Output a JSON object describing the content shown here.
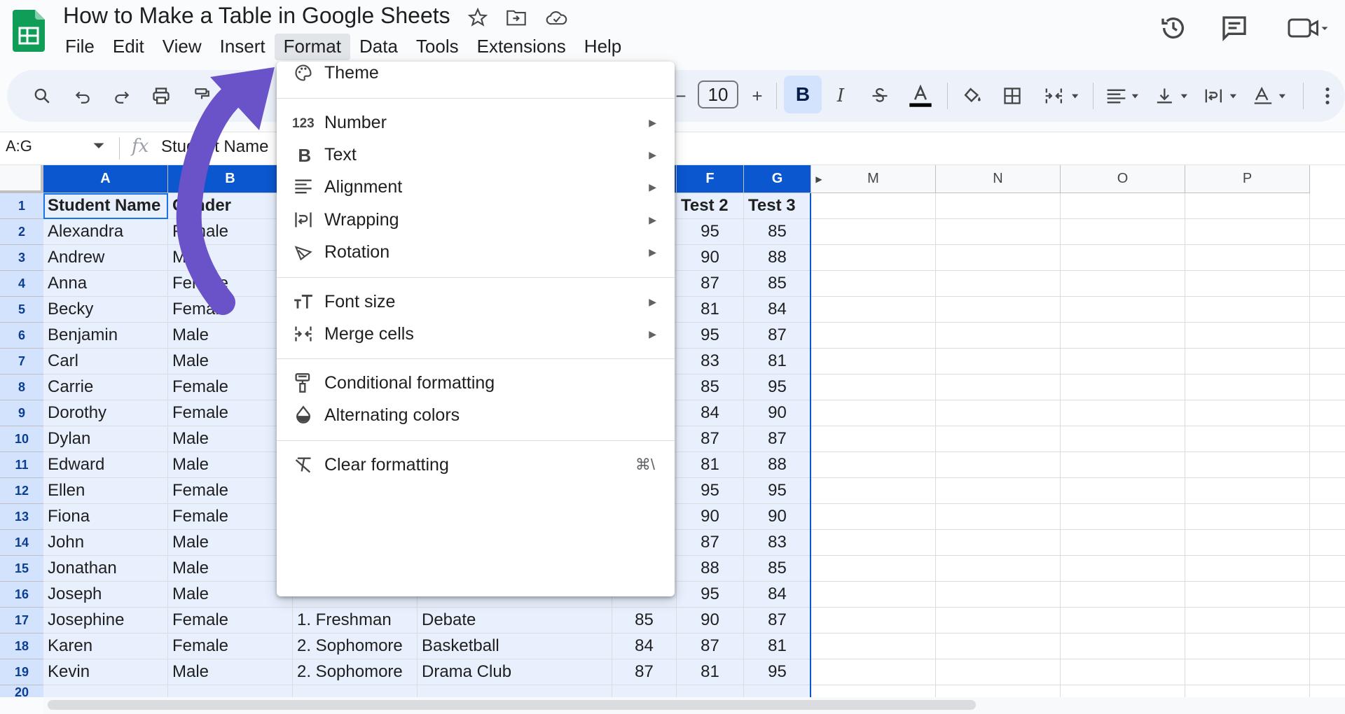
{
  "app": {
    "doc_title": "How to Make a Table in Google Sheets",
    "menus": [
      "File",
      "Edit",
      "View",
      "Insert",
      "Format",
      "Data",
      "Tools",
      "Extensions",
      "Help"
    ],
    "active_menu": "Format",
    "brand_color": "#0f9d58"
  },
  "toolbar": {
    "font_size": "10",
    "bold_label": "B",
    "italic_label": "I"
  },
  "formula_bar": {
    "name_box": "A:G",
    "fx": "fx",
    "content": "Student Name"
  },
  "grid": {
    "columns": [
      "A",
      "B",
      "F",
      "G",
      "M",
      "N",
      "O",
      "P"
    ],
    "row_numbers": [
      "1",
      "2",
      "3",
      "4",
      "5",
      "6",
      "7",
      "8",
      "9",
      "10",
      "11",
      "12",
      "13",
      "14",
      "15",
      "16",
      "17",
      "18",
      "19",
      "20"
    ],
    "header_row": {
      "A": "Student Name",
      "B": "Gender",
      "F": "Test 2",
      "G": "Test 3"
    },
    "rows": [
      {
        "A": "Alexandra",
        "B": "Female",
        "F": "95",
        "G": "85"
      },
      {
        "A": "Andrew",
        "B": "Male",
        "F": "90",
        "G": "88"
      },
      {
        "A": "Anna",
        "B": "Female",
        "F": "87",
        "G": "85"
      },
      {
        "A": "Becky",
        "B": "Female",
        "F": "81",
        "G": "84"
      },
      {
        "A": "Benjamin",
        "B": "Male",
        "F": "95",
        "G": "87"
      },
      {
        "A": "Carl",
        "B": "Male",
        "F": "83",
        "G": "81"
      },
      {
        "A": "Carrie",
        "B": "Female",
        "F": "85",
        "G": "95"
      },
      {
        "A": "Dorothy",
        "B": "Female",
        "F": "84",
        "G": "90"
      },
      {
        "A": "Dylan",
        "B": "Male",
        "F": "87",
        "G": "87"
      },
      {
        "A": "Edward",
        "B": "Male",
        "F": "81",
        "G": "88"
      },
      {
        "A": "Ellen",
        "B": "Female",
        "F": "95",
        "G": "95"
      },
      {
        "A": "Fiona",
        "B": "Female",
        "F": "90",
        "G": "90"
      },
      {
        "A": "John",
        "B": "Male",
        "F": "87",
        "G": "83"
      },
      {
        "A": "Jonathan",
        "B": "Male",
        "F": "88",
        "G": "85"
      },
      {
        "A": "Joseph",
        "B": "Male",
        "F": "95",
        "G": "84"
      },
      {
        "A": "Josephine",
        "B": "Female",
        "C": "1. Freshman",
        "D": "Debate",
        "E": "85",
        "F": "90",
        "G": "87"
      },
      {
        "A": "Karen",
        "B": "Female",
        "C": "2. Sophomore",
        "D": "Basketball",
        "E": "84",
        "F": "87",
        "G": "81"
      },
      {
        "A": "Kevin",
        "B": "Male",
        "C": "2. Sophomore",
        "D": "Drama Club",
        "E": "87",
        "F": "81",
        "G": "95"
      }
    ]
  },
  "format_menu": {
    "items": [
      {
        "label": "Theme",
        "icon": "palette-icon",
        "submenu": false
      },
      {
        "label": "Number",
        "icon": "number-123-icon",
        "submenu": true
      },
      {
        "label": "Text",
        "icon": "bold-b-icon",
        "submenu": true
      },
      {
        "label": "Alignment",
        "icon": "align-left-icon",
        "submenu": true
      },
      {
        "label": "Wrapping",
        "icon": "wrap-icon",
        "submenu": true
      },
      {
        "label": "Rotation",
        "icon": "rotation-icon",
        "submenu": true
      },
      {
        "label": "Font size",
        "icon": "font-size-icon",
        "submenu": true
      },
      {
        "label": "Merge cells",
        "icon": "merge-cells-icon",
        "submenu": true
      },
      {
        "label": "Conditional formatting",
        "icon": "paint-roller-icon",
        "submenu": false
      },
      {
        "label": "Alternating colors",
        "icon": "droplet-icon",
        "submenu": false
      },
      {
        "label": "Clear formatting",
        "icon": "clear-format-icon",
        "submenu": false,
        "shortcut": "⌘\\"
      }
    ]
  },
  "annotation": {
    "arrow_color": "#6a52c9"
  }
}
